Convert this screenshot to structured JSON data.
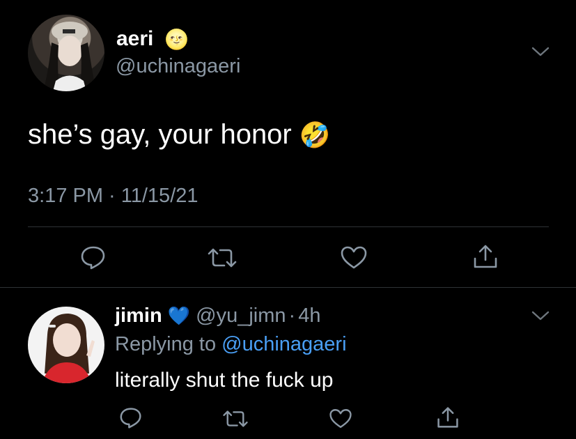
{
  "main_tweet": {
    "display_name": "aeri",
    "name_emoji": "🌝",
    "handle": "@uchinagaeri",
    "text": "she’s gay, your honor",
    "text_emoji": "🤣",
    "timestamp": "3:17 PM · 11/15/21"
  },
  "reply": {
    "display_name": "jimin",
    "name_emoji": "💙",
    "handle": "@yu_jimn",
    "separator": "·",
    "time": "4h",
    "replying_prefix": "Replying to",
    "replying_handle": "@uchinagaeri",
    "text": "literally shut the fuck up"
  },
  "icons": {
    "reply": "speech-bubble-icon",
    "retweet": "retweet-icon",
    "like": "heart-icon",
    "share": "share-icon",
    "more": "chevron-down-icon"
  },
  "colors": {
    "background": "#000000",
    "text": "#e7e9ea",
    "muted": "#8b98a5",
    "link": "#4a9ff5",
    "divider": "#2f3336"
  }
}
